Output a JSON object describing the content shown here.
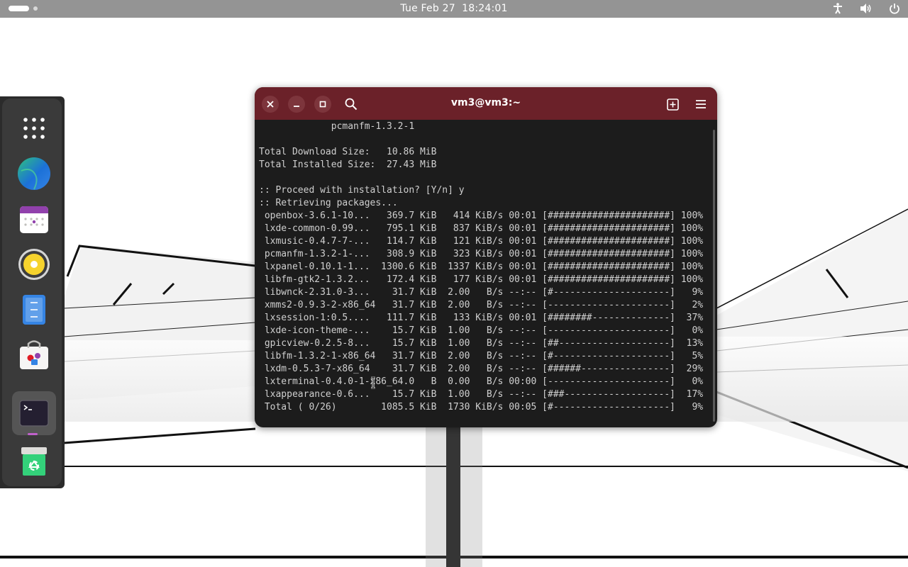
{
  "topbar": {
    "clock": "Tue Feb 27  18:24:01"
  },
  "icons": {
    "accessibility": "accessibility-icon",
    "volume": "volume-icon",
    "power": "power-icon",
    "app_grid": "app-grid-icon",
    "browser": "browser-icon",
    "calendar": "calendar-icon",
    "music": "music-player-icon",
    "text_editor": "text-editor-icon",
    "software": "software-store-icon",
    "terminal": "terminal-icon",
    "trash": "trash-icon"
  },
  "colors": {
    "headerbar": "#6b2129",
    "terminal_bg": "#1c1c1c",
    "terminal_fg": "#d0d0d0",
    "topbar": "#949494"
  },
  "terminal": {
    "title": "vm3@vm3:~",
    "lines": [
      "             pcmanfm-1.3.2-1",
      "",
      "Total Download Size:   10.86 MiB",
      "Total Installed Size:  27.43 MiB",
      "",
      ":: Proceed with installation? [Y/n] y",
      ":: Retrieving packages...",
      " openbox-3.6.1-10...   369.7 KiB   414 KiB/s 00:01 [######################] 100%",
      " lxde-common-0.99...   795.1 KiB   837 KiB/s 00:01 [######################] 100%",
      " lxmusic-0.4.7-7-...   114.7 KiB   121 KiB/s 00:01 [######################] 100%",
      " pcmanfm-1.3.2-1-...   308.9 KiB   323 KiB/s 00:01 [######################] 100%",
      " lxpanel-0.10.1-1...  1300.6 KiB  1337 KiB/s 00:01 [######################] 100%",
      " libfm-gtk2-1.3.2...   172.4 KiB   177 KiB/s 00:01 [######################] 100%",
      " libwnck-2.31.0-3...    31.7 KiB  2.00   B/s --:-- [#---------------------]   9%",
      " xmms2-0.9.3-2-x86_64   31.7 KiB  2.00   B/s --:-- [----------------------]   2%",
      " lxsession-1:0.5....   111.7 KiB   133 KiB/s 00:01 [########--------------]  37%",
      " lxde-icon-theme-...    15.7 KiB  1.00   B/s --:-- [----------------------]   0%",
      " gpicview-0.2.5-8...    15.7 KiB  1.00   B/s --:-- [##--------------------]  13%",
      " libfm-1.3.2-1-x86_64   31.7 KiB  2.00   B/s --:-- [#---------------------]   5%",
      " lxdm-0.5.3-7-x86_64    31.7 KiB  2.00   B/s --:-- [######----------------]  29%",
      " lxterminal-0.4.0-1-x86_64.0   B  0.00   B/s 00:00 [----------------------]   0%",
      " lxappearance-0.6...    15.7 KiB  1.00   B/s --:-- [###-------------------]  17%",
      " Total ( 0/26)        1085.5 KiB  1730 KiB/s 00:05 [#---------------------]   9%"
    ]
  }
}
